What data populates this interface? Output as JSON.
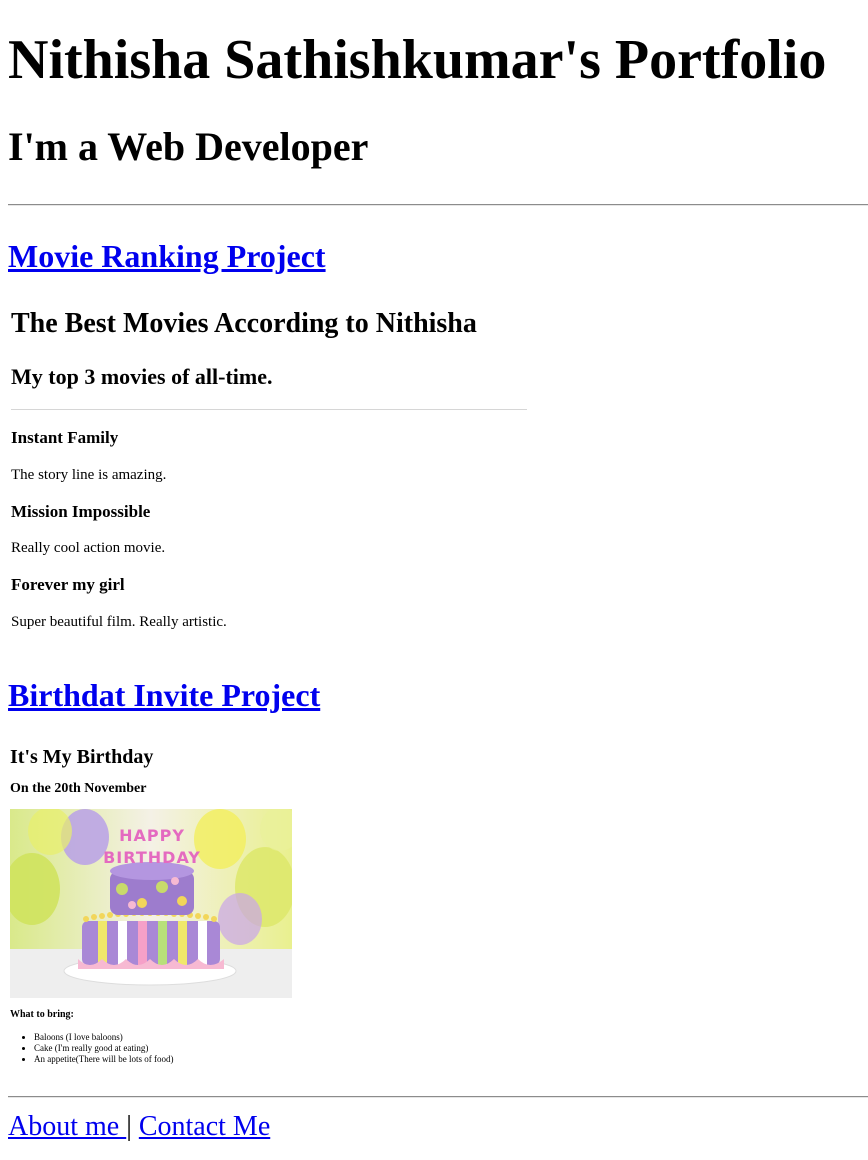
{
  "header": {
    "title": "Nithisha Sathishkumar's Portfolio",
    "subtitle": "I'm a Web Developer"
  },
  "projects": [
    {
      "link_label": "Movie Ranking Project"
    },
    {
      "link_label": "Birthdat Invite Project"
    }
  ],
  "movie_page": {
    "title": "The Best Movies According to Nithisha",
    "subtitle": "My top 3 movies of all-time.",
    "movies": [
      {
        "name": "Instant Family",
        "description": "The story line is amazing."
      },
      {
        "name": "Mission Impossible",
        "description": "Really cool action movie."
      },
      {
        "name": "Forever my girl",
        "description": "Super beautiful film. Really artistic."
      }
    ]
  },
  "birthday_page": {
    "title": "It's My Birthday",
    "date": "On the 20th November",
    "cake_candle_text": "HAPPY BIRTHDAY",
    "bring_label": "What to bring:",
    "bring_items": [
      "Baloons (I love baloons)",
      "Cake (I'm really good at eating)",
      "An appetite(There will be lots of food)"
    ]
  },
  "footer": {
    "about_label": "About me ",
    "separator": " | ",
    "contact_label": "Contact Me"
  },
  "colors": {
    "link": "#0000ee",
    "text": "#000000",
    "rule": "#8c8c8c"
  }
}
